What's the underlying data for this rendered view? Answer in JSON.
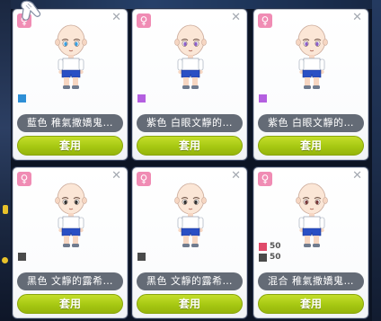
{
  "cards": [
    {
      "gender": "♀",
      "swatch_color": "#2e8fd6",
      "mixed": false,
      "eye_color": "#3aa0e0",
      "label": "藍色 稚氣撒嬌鬼…",
      "button": "套用"
    },
    {
      "gender": "♀",
      "swatch_color": "#b45fe0",
      "mixed": false,
      "eye_color": "#8d5fc8",
      "label": "紫色 白眼文靜的…",
      "button": "套用"
    },
    {
      "gender": "♀",
      "swatch_color": "#b45fe0",
      "mixed": false,
      "eye_color": "#8d5fc8",
      "label": "紫色 白眼文靜的…",
      "button": "套用"
    },
    {
      "gender": "♀",
      "swatch_color": "#4a4a4a",
      "mixed": false,
      "eye_color": "#333333",
      "label": "黑色 文靜的露希…",
      "button": "套用"
    },
    {
      "gender": "♀",
      "swatch_color": "#4a4a4a",
      "mixed": false,
      "eye_color": "#333333",
      "label": "黑色 文靜的露希…",
      "button": "套用"
    },
    {
      "gender": "♀",
      "swatch_color": "#e04a6a",
      "mixed": true,
      "mix": [
        {
          "color": "#e04a6a",
          "value": "50"
        },
        {
          "color": "#4a4a4a",
          "value": "50"
        }
      ],
      "eye_color": "#7a3a3a",
      "label": "混合 稚氣撒嬌鬼…",
      "button": "套用"
    }
  ]
}
